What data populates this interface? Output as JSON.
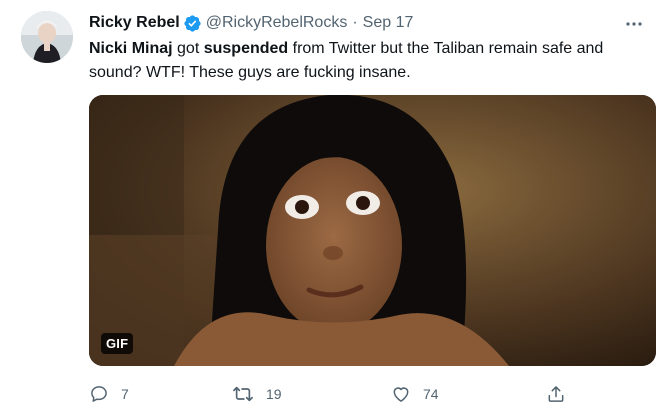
{
  "tweet": {
    "display_name": "Ricky Rebel",
    "handle": "@RickyRebelRocks",
    "separator": "·",
    "date": "Sep 17",
    "text": {
      "part1": "Nicki Minaj",
      "part2": " got ",
      "part3": "suspended",
      "part4": " from Twitter but the Taliban remain safe and sound? WTF! These guys are fucking insane."
    },
    "media": {
      "badge": "GIF"
    },
    "actions": {
      "reply_count": "7",
      "retweet_count": "19",
      "like_count": "74"
    }
  },
  "colors": {
    "verified": "#1d9bf0",
    "secondary_text": "#536471",
    "primary_text": "#0f1419"
  },
  "icons": {
    "verified": "verified-badge-icon",
    "more": "more-options-icon",
    "reply": "reply-icon",
    "retweet": "retweet-icon",
    "like": "heart-icon",
    "share": "share-icon"
  }
}
